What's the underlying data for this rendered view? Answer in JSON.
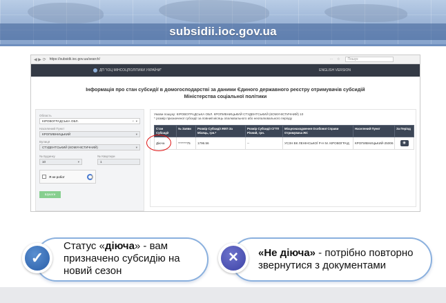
{
  "slide": {
    "site": "subsidii.ioc.gov.ua"
  },
  "browser": {
    "url": "https://subsidii.ioc.gov.ua/search/",
    "search_placeholder": "Пошук"
  },
  "site_header": {
    "logo_text": "ДП \"ІОЦ МІНСОЦПОЛІТИКИ УКРАЇНИ\"",
    "lang": "ENGLISH VERSION"
  },
  "page": {
    "title_line1": "Інформація про стан субсидії в домогосподарстві за даними Єдиного державного реєстру отримувачів субсидій",
    "title_line2": "Міністерства соціальної політики"
  },
  "form": {
    "oblast_label": "Область",
    "oblast_value": "КІРОВОГРАДСЬКА ОБЛ.",
    "city_label": "Населений Пункт",
    "city_value": "КРОПИВНИЦЬКИЙ",
    "street_label": "Вулиця",
    "street_value": "СТУДЕНТСЬКИЙ (КОМУНІСТИЧНИЙ)",
    "house_label": "№ Будинку",
    "house_value": "10",
    "apt_label": "№ Квартири",
    "apt_value": "1",
    "captcha_label": "Я не робот",
    "submit_label": "Шукати"
  },
  "results": {
    "query": "Умови пошуку: КІРОВОГРАДСЬКА ОБЛ. КРОПИВНИЦЬКИЙ СТУДЕНТСЬКИЙ (КОМУНІСТИЧНИЙ) 10",
    "note": "* розмір призначеної субсидії за повний місяць опалювального або неопалювального періоду",
    "columns": [
      "Стан Субсидії",
      "№ Заяви",
      "Розмір Субсидії ЖКП За Місяць, грн.*",
      "Розмір Субсидії СГТП Річний, грн.",
      "Місцезнаходження Особової Справи Отримувача ЖС",
      "Населений Пункт",
      "За Період"
    ],
    "row": {
      "status": "Діюча",
      "application": "*******75",
      "monthly": "1796.56",
      "annual": "--",
      "office": "УСЗН ВК ЛЕНІНСЬКОЇ Р-Н М. КІРОВОГРАД",
      "locality": "КРОПИВНИЦЬКИЙ-25006"
    }
  },
  "callouts": {
    "left": {
      "prefix": "Статус «",
      "bold": "діюча",
      "suffix": "» - вам призначено субсидію на новий сезон"
    },
    "right": {
      "bold": "«Не діюча»",
      "suffix": " -  потрібно повторно звернутися з документами"
    }
  },
  "icons": {
    "left_badge": "check-icon",
    "right_badge": "cross-icon"
  }
}
